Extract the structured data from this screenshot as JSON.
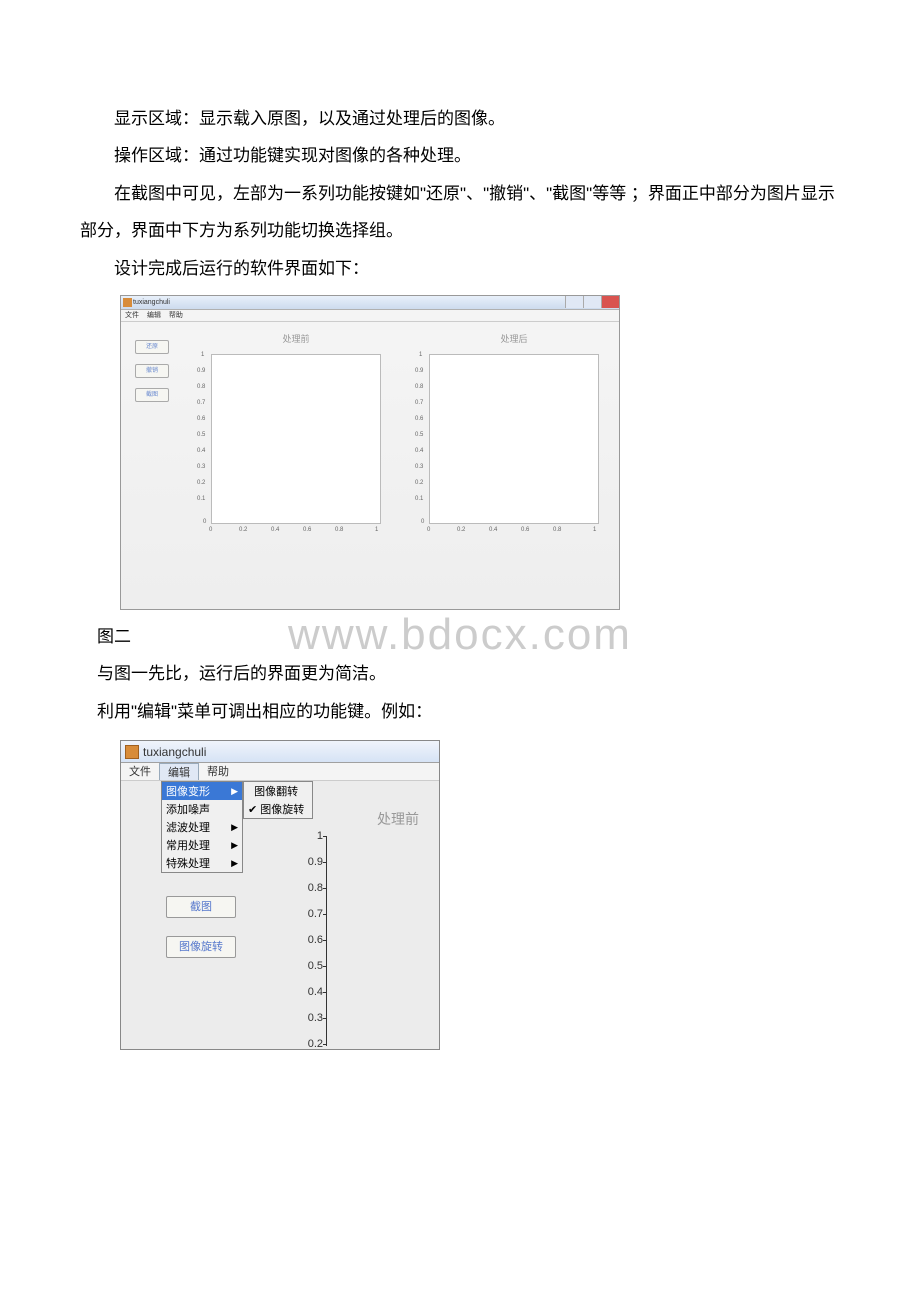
{
  "doc": {
    "p1": "显示区域：显示载入原图，以及通过处理后的图像。",
    "p2": "操作区域：通过功能键实现对图像的各种处理。",
    "p3": "在截图中可见，左部为一系列功能按键如\"还原\"、\"撤销\"、\"截图\"等等 ；界面正中部分为图片显示部分，界面中下方为系列功能切换选择组。",
    "p4": "设计完成后运行的软件界面如下：",
    "caption1": "图二",
    "p5": "与图一先比，运行后的界面更为简洁。",
    "p6": "利用\"编辑\"菜单可调出相应的功能键。例如："
  },
  "watermark": "www.bdocx.com",
  "shot1": {
    "title": "tuxiangchuli",
    "menu": [
      "文件",
      "编辑",
      "帮助"
    ],
    "buttons": {
      "b1": "还原",
      "b2": "撤销",
      "b3": "截图"
    },
    "chart_titles": {
      "left": "处理前",
      "right": "处理后"
    }
  },
  "shot2": {
    "title": "tuxiangchuli",
    "menu": [
      "文件",
      "编辑",
      "帮助"
    ],
    "dropdown": [
      "图像变形",
      "添加噪声",
      "滤波处理",
      "常用处理",
      "特殊处理"
    ],
    "submenu": [
      "图像翻转",
      "图像旋转"
    ],
    "buttons": {
      "b1": "截图",
      "b2": "图像旋转"
    },
    "chart_title": "处理前",
    "yticks": [
      "1",
      "0.9",
      "0.8",
      "0.7",
      "0.6",
      "0.5",
      "0.4",
      "0.3",
      "0.2"
    ]
  },
  "chart_data": [
    {
      "type": "line",
      "title": "处理前",
      "categories": [],
      "values": [],
      "xlim": [
        0,
        1
      ],
      "ylim": [
        0,
        1
      ],
      "xticks": [
        0,
        0.2,
        0.4,
        0.6,
        0.8,
        1
      ],
      "yticks": [
        0,
        0.1,
        0.2,
        0.3,
        0.4,
        0.5,
        0.6,
        0.7,
        0.8,
        0.9,
        1
      ],
      "xlabel": "",
      "ylabel": ""
    },
    {
      "type": "line",
      "title": "处理后",
      "categories": [],
      "values": [],
      "xlim": [
        0,
        1
      ],
      "ylim": [
        0,
        1
      ],
      "xticks": [
        0,
        0.2,
        0.4,
        0.6,
        0.8,
        1
      ],
      "yticks": [
        0,
        0.1,
        0.2,
        0.3,
        0.4,
        0.5,
        0.6,
        0.7,
        0.8,
        0.9,
        1
      ],
      "xlabel": "",
      "ylabel": ""
    },
    {
      "type": "line",
      "title": "处理前",
      "categories": [],
      "values": [],
      "xlim": [
        0,
        1
      ],
      "ylim": [
        0,
        1
      ],
      "yticks": [
        0.2,
        0.3,
        0.4,
        0.5,
        0.6,
        0.7,
        0.8,
        0.9,
        1
      ],
      "xlabel": "",
      "ylabel": ""
    }
  ]
}
